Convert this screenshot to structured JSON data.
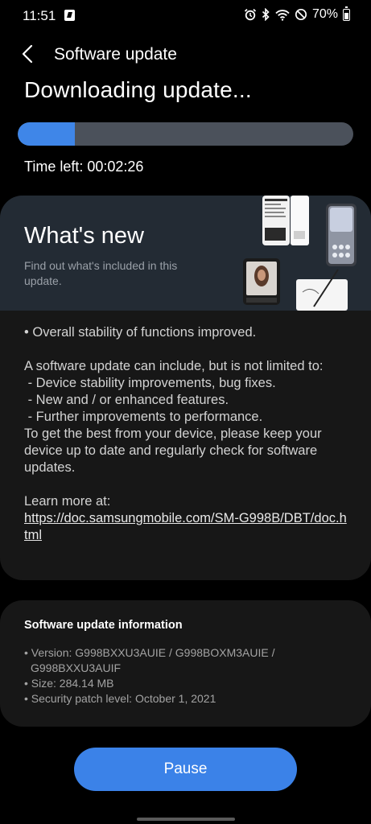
{
  "status_bar": {
    "time": "11:51",
    "battery": "70%",
    "icons": [
      "message-app-icon",
      "alarm-icon",
      "bluetooth-icon",
      "wifi-icon",
      "do-not-disturb-icon",
      "battery-icon"
    ]
  },
  "app_bar": {
    "title": "Software update",
    "back_icon": "chevron-left-icon"
  },
  "download": {
    "heading": "Downloading update...",
    "progress": 0.17,
    "time_left": "Time left: 00:02:26",
    "colors": {
      "accent": "#3f86e8",
      "track": "#4b515b"
    }
  },
  "whats_new": {
    "title": "What's new",
    "subtitle": "Find out what's included in this update.",
    "intro": "• Overall stability of functions improved.",
    "paragraph": "A software update can include, but is not limited to:",
    "items": [
      " - Device stability improvements, bug fixes.",
      " - New and / or enhanced features.",
      " - Further improvements to performance."
    ],
    "closing": "To get the best from your device, please keep your device up to date and regularly check for software updates.",
    "learn_more_label": "Learn more at:",
    "learn_more_url": "https://doc.samsungmobile.com/SM-G998B/DBT/doc.html"
  },
  "info": {
    "title": "Software update information",
    "version_label": "• Version: G998BXXU3AUIE / G998BOXM3AUIE /",
    "version_cont": "G998BXXU3AUIF",
    "size": "• Size: 284.14 MB",
    "security_patch": "• Security patch level: October 1, 2021"
  },
  "pause_button": {
    "label": "Pause"
  }
}
